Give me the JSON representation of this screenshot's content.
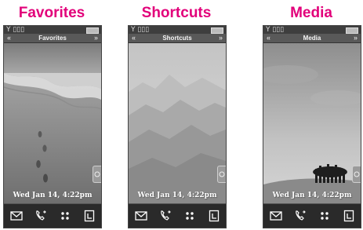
{
  "panels": [
    {
      "title": "Favorites",
      "screen_title": "Favorites",
      "datetime": "Wed Jan 14, 4:22pm",
      "wallpaper": "beach-footprints"
    },
    {
      "title": "Shortcuts",
      "screen_title": "Shortcuts",
      "datetime": "Wed Jan 14, 4:22pm",
      "wallpaper": "misty-mountains"
    },
    {
      "title": "Media",
      "screen_title": "Media",
      "datetime": "Wed Jan 14, 4:22pm",
      "wallpaper": "field-trees"
    }
  ],
  "statusbar": {
    "signal_glyph": "Y",
    "network_glyph": "3G"
  },
  "nav": {
    "left_arrow": "«",
    "right_arrow": "»"
  },
  "dock": {
    "icons": [
      "envelope-icon",
      "phone-icon",
      "dots-grid-icon",
      "contacts-icon"
    ]
  },
  "colors": {
    "title_accent": "#e2007a",
    "bar": "#595959"
  }
}
